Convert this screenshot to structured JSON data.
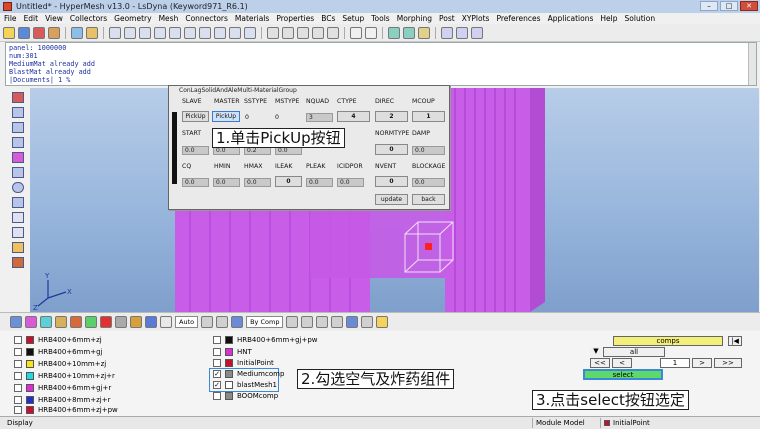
{
  "window": {
    "title": "Untitled* - HyperMesh v13.0 - LsDyna (Keyword971_R6.1)",
    "controls": [
      "–",
      "□",
      "✕"
    ]
  },
  "menu": [
    "File",
    "Edit",
    "View",
    "Collectors",
    "Geometry",
    "Mesh",
    "Connectors",
    "Materials",
    "Properties",
    "BCs",
    "Setup",
    "Tools",
    "Morphing",
    "Post",
    "XYPlots",
    "Preferences",
    "Applications",
    "Help",
    "Solution"
  ],
  "command_window": {
    "lines": [
      "panel: 1000000",
      "num:301",
      "MediumMat already add",
      "BlastMat already add",
      "|Documents| 1 %"
    ]
  },
  "dialog": {
    "title": "ConLagSolidAndAleMulti-MaterialGroup",
    "row1_labels": [
      "SLAVE",
      "MASTER",
      "SSTYPE",
      "MSTYPE",
      "NQUAD",
      "CTYPE",
      "DIREC",
      "MCOUP"
    ],
    "pickup_label": "PickUp",
    "row1_values": {
      "sstype": "0",
      "mstype": "0",
      "nquad": "3",
      "ctype": "4",
      "direc": "2",
      "mcoup": "1"
    },
    "row2_labels": [
      "START",
      "NORMTYPE",
      "DAMP"
    ],
    "row2_values": {
      "start": "0.0",
      "f2": "0.0",
      "f3": "0.2",
      "f4": "0.0",
      "normtype": "0",
      "damp": "0.0"
    },
    "row3_labels": [
      "CQ",
      "HMIN",
      "HMAX",
      "ILEAK",
      "PLEAK",
      "ICIDPOR",
      "NVENT",
      "BLOCKAGE"
    ],
    "row3_values": {
      "cq": "0.0",
      "hmin": "0.0",
      "hmax": "0.0",
      "ileak": "0",
      "pleak": "0.0",
      "icidpor": "0.0",
      "nvent": "0",
      "blockage": "0.0"
    },
    "update_label": "update",
    "back_label": "back"
  },
  "annotations": {
    "step1": "1.单击PickUp按钮",
    "step2": "2.勾选空气及炸药组件",
    "step3": "3.点击select按钮选定"
  },
  "bottom_toolbar": {
    "auto_label": "Auto",
    "bycomp_label": "By Comp"
  },
  "components_left": [
    {
      "name": "HRB400+6mm+zj",
      "color": "#c8102e"
    },
    {
      "name": "HRB400+6mm+gj",
      "color": "#101010"
    },
    {
      "name": "HRB400+10mm+zj",
      "color": "#f5e61a"
    },
    {
      "name": "HRB400+10mm+zj+r",
      "color": "#20d7e6"
    },
    {
      "name": "HRB400+6mm+gj+r",
      "color": "#e02bd7"
    },
    {
      "name": "HRB400+8mm+zj+r",
      "color": "#2030c8"
    },
    {
      "name": "HRB400+6mm+zj+pw",
      "color": "#c8102e"
    }
  ],
  "components_right": [
    {
      "name": "HRB400+6mm+gj+pw",
      "color": "#101010",
      "checked": false
    },
    {
      "name": "HNT",
      "color": "#e02bd7",
      "checked": false
    },
    {
      "name": "InitialPoint",
      "color": "#c8102e",
      "checked": false
    },
    {
      "name": "Mediumcomp",
      "color": "#8a8a8a",
      "checked": true
    },
    {
      "name": "blastMesh1",
      "color": "#ffffff",
      "checked": true
    },
    {
      "name": "BOOMcomp",
      "color": "#8a8a8a",
      "checked": false
    }
  ],
  "selector": {
    "comps_label": "comps",
    "all_label": "all",
    "page_number": "1",
    "select_label": "select",
    "nav_first": "|◀",
    "nav_prev2": "<<",
    "nav_prev": "<",
    "nav_next": ">",
    "nav_next2": ">>",
    "dropdown_arrow": "▼"
  },
  "status": {
    "left": "Display",
    "module": "Module Model",
    "component": "InitialPoint"
  },
  "colors": {
    "structure_magenta": "#cc44e6",
    "highlight_yellow": "#f2f07a",
    "select_green": "#5fd86a",
    "blue_box": "#3a88d8"
  }
}
